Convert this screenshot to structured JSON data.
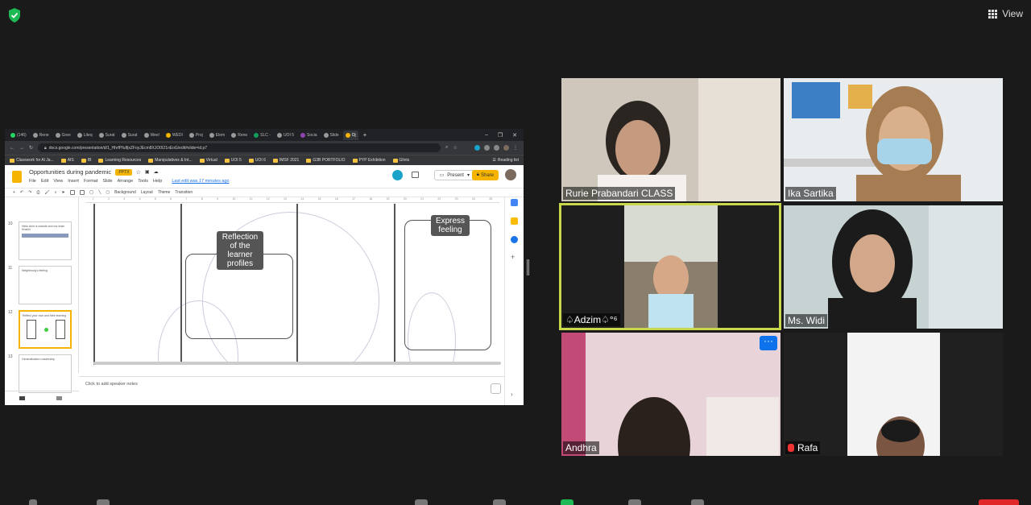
{
  "zoom": {
    "view_label": "View",
    "security_icon": "shield-check-icon",
    "colors": {
      "active_speaker_border": "#c8d84a",
      "more_button": "#0e72ed",
      "muted_mic": "#e33333",
      "slides_accent": "#f4b400"
    }
  },
  "browser": {
    "tabs": [
      {
        "label": "(146)"
      },
      {
        "label": "Rene"
      },
      {
        "label": "Gree"
      },
      {
        "label": "Liteq"
      },
      {
        "label": "Surat"
      },
      {
        "label": "Surat"
      },
      {
        "label": "Weel"
      },
      {
        "label": "WEDI"
      },
      {
        "label": "Proj"
      },
      {
        "label": "Elem"
      },
      {
        "label": "Rene"
      },
      {
        "label": "SLC -"
      },
      {
        "label": "UOI 5"
      },
      {
        "label": "Socia"
      },
      {
        "label": "Slide"
      },
      {
        "label": "Oj"
      }
    ],
    "url": "docs.google.com/presentation/d/1_HhrfPfuIfjxZFoyJEcm8XJO0I21nEoG/edit#slide=id.p7",
    "bookmarks": [
      "Classwork for Al Ja...",
      "AIS",
      "IB",
      "Learning Resources",
      "Manipulatives & Int...",
      "Virtual",
      "UOI 5",
      "UOI 6",
      "IMSF 2021",
      "G3B PORTFOLIO",
      "PYP Exhibition",
      "Glints"
    ],
    "reading_list": "Reading list"
  },
  "slides": {
    "title": "Opportunities during pandemic",
    "format_badge": ".PPTX",
    "menus": [
      "File",
      "Edit",
      "View",
      "Insert",
      "Format",
      "Slide",
      "Arrange",
      "Tools",
      "Help"
    ],
    "last_edit": "Last edit was 17 minutes ago",
    "present_label": "Present",
    "share_label": "Share",
    "toolbar": [
      "Background",
      "Layout",
      "Theme",
      "Transition"
    ],
    "thumbnails": [
      {
        "num": "10",
        "text": "Hello Arch is outside and our team Khahiri"
      },
      {
        "num": "11",
        "text": "Neighbourg's feeling"
      },
      {
        "num": "12",
        "text": "Reflect your own and their learning"
      },
      {
        "num": "13",
        "text": "Generalization Leadership"
      }
    ],
    "ruler": [
      "1",
      "2",
      "3",
      "4",
      "5",
      "6",
      "7",
      "8",
      "9",
      "10",
      "11",
      "12",
      "13",
      "14",
      "15",
      "16",
      "17",
      "18",
      "19",
      "20",
      "21",
      "22",
      "23",
      "24",
      "25"
    ],
    "slide_labels": {
      "reflection": "Reflection of the learner profiles",
      "express": "Express feeling"
    },
    "speaker_notes": "Click to add speaker notes"
  },
  "participants": [
    {
      "name": "Rurie Prabandari CLASS",
      "muted": false
    },
    {
      "name": "Ika Sartika",
      "muted": false
    },
    {
      "name": "♤Adzim♤°⁶",
      "muted": false,
      "active": true
    },
    {
      "name": "Ms. Widi",
      "muted": false
    },
    {
      "name": "Andhra",
      "muted": false
    },
    {
      "name": "Rafa",
      "muted": true
    }
  ],
  "tile_more_label": "···"
}
